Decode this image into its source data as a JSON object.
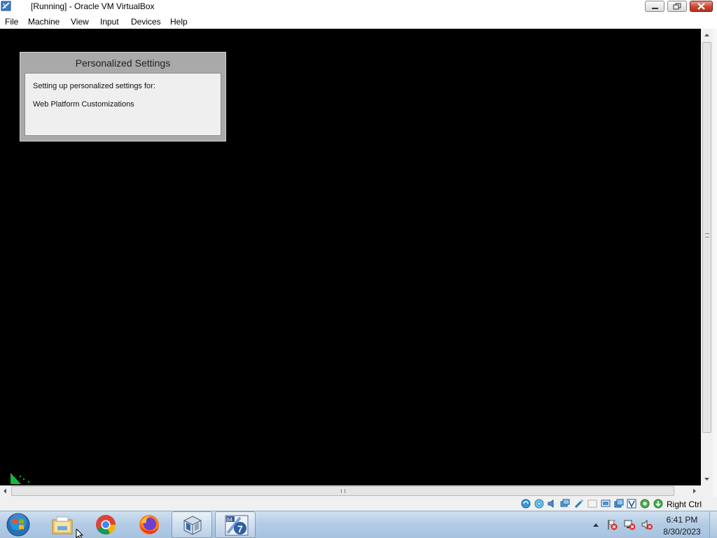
{
  "window": {
    "title": "[Running] - Oracle VM VirtualBox",
    "icon": "virtualbox-vm-icon"
  },
  "caption_buttons": [
    "minimize-icon",
    "restore-icon",
    "close-icon"
  ],
  "menubar": {
    "items": [
      {
        "label": "File"
      },
      {
        "label": "Machine"
      },
      {
        "label": "View"
      },
      {
        "label": "Input"
      },
      {
        "label": "Devices"
      },
      {
        "label": "Help"
      }
    ]
  },
  "vm": {
    "dialog": {
      "title": "Personalized Settings",
      "line1": "Setting up personalized settings for:",
      "line2": "Web Platform Customizations"
    }
  },
  "statusbar": {
    "icons": [
      "hard-disk-icon",
      "optical-drive-icon",
      "audio-icon",
      "network-icon",
      "usb-icon",
      "shared-folders-icon",
      "display-icon",
      "recording-icon",
      "virtualization-icon",
      "mouse-integration-icon",
      "keyboard-icon"
    ],
    "host_key": "Right Ctrl"
  },
  "taskbar": {
    "apps": [
      "file-explorer-icon",
      "chrome-icon",
      "firefox-icon",
      "virtualbox-icon",
      "windows7-vm-icon"
    ],
    "vm_badge": "64",
    "vm_number": "7",
    "tray_icons": [
      "action-center-flag-icon",
      "network-tray-icon",
      "volume-muted-icon"
    ],
    "clock_time": "6:41 PM",
    "clock_date": "8/30/2023"
  },
  "colors": {
    "vm_background": "#000000",
    "dialog_frame": "#a9a9a9",
    "dialog_body": "#efefef",
    "taskbar": "#b4cde6",
    "close_button": "#c74533"
  }
}
